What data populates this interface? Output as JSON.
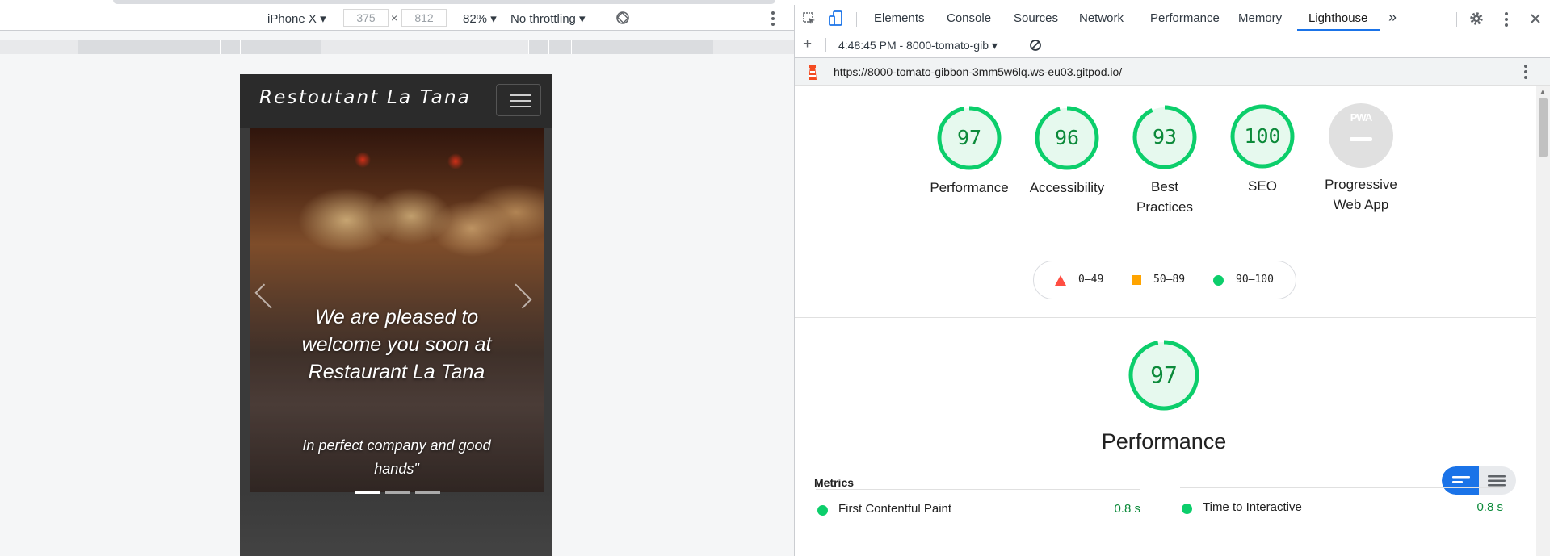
{
  "device_toolbar": {
    "device": "iPhone X",
    "width": "375",
    "times": "×",
    "height": "812",
    "zoom": "82%",
    "throttling": "No throttling"
  },
  "site": {
    "brand": "Restoutant La Tana",
    "caption": "We are pleased to welcome you soon at Restaurant La Tana",
    "subcaption": "In perfect company and good hands\""
  },
  "devtools": {
    "tabs": [
      "Elements",
      "Console",
      "Sources",
      "Network",
      "Performance",
      "Memory",
      "Lighthouse"
    ],
    "active_tab": "Lighthouse",
    "more": "»",
    "add": "+",
    "report": "4:48:45 PM - 8000-tomato-gib",
    "url": "https://8000-tomato-gibbon-3mm5w6lq.ws-eu03.gitpod.io/"
  },
  "lighthouse": {
    "categories": [
      {
        "score": "97",
        "label": "Performance",
        "value": 97
      },
      {
        "score": "96",
        "label": "Accessibility",
        "value": 96
      },
      {
        "score": "93",
        "label": "Best Practices",
        "value": 93
      },
      {
        "score": "100",
        "label": "SEO",
        "value": 100
      }
    ],
    "pwa": {
      "badge": "PWA",
      "label": "Progressive Web App"
    },
    "legend": [
      {
        "range": "0–49",
        "color": "#ff4e42"
      },
      {
        "range": "50–89",
        "color": "#ffa400"
      },
      {
        "range": "90–100",
        "color": "#0cce6b"
      }
    ],
    "main_score": {
      "score": "97",
      "label": "Performance",
      "value": 97
    },
    "metrics_title": "Metrics",
    "metrics": [
      {
        "name": "First Contentful Paint",
        "value": "0.8 s"
      },
      {
        "name": "Time to Interactive",
        "value": "0.8 s"
      }
    ]
  },
  "colors": {
    "pass": "#0cce6b",
    "pass_text": "#0c8a3a",
    "accent": "#1a73e8"
  }
}
